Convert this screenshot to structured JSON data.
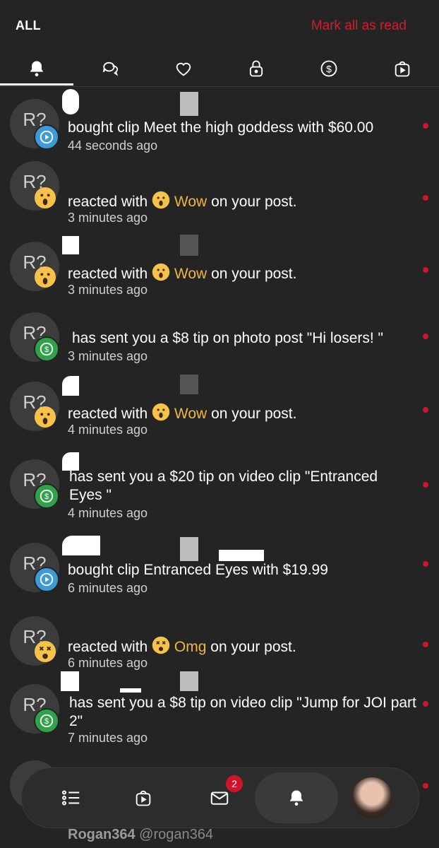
{
  "header": {
    "filter": "ALL",
    "mark_all": "Mark all as read"
  },
  "tabs": [
    {
      "name": "bell-icon"
    },
    {
      "name": "chat-icon"
    },
    {
      "name": "heart-icon"
    },
    {
      "name": "lock-icon"
    },
    {
      "name": "dollar-circle-icon"
    },
    {
      "name": "video-bag-icon"
    }
  ],
  "notifications": [
    {
      "avatar": "R?",
      "badge": "play",
      "text": "bought clip Meet the high goddess with $60.00",
      "time": "44 seconds ago"
    },
    {
      "avatar": "R?",
      "badge": "wow",
      "pre": "reacted with",
      "reaction": "Wow",
      "post": "on your post.",
      "time": "3 minutes ago"
    },
    {
      "avatar": "R?",
      "badge": "wow",
      "pre": "reacted with",
      "reaction": "Wow",
      "post": "on your post.",
      "time": "3 minutes ago"
    },
    {
      "avatar": "R?",
      "badge": "dollar",
      "text": "has sent you a $8 tip on photo post \"Hi losers! \"",
      "time": "3 minutes ago"
    },
    {
      "avatar": "R?",
      "badge": "wow",
      "pre": "reacted with",
      "reaction": "Wow",
      "post": "on your post.",
      "time": "4 minutes ago"
    },
    {
      "avatar": "R?",
      "badge": "dollar",
      "text": "has sent you a $20 tip on video clip \"Entranced Eyes \"",
      "time": "4 minutes ago"
    },
    {
      "avatar": "R?",
      "badge": "play",
      "text": "bought clip Entranced Eyes with $19.99",
      "time": "6 minutes ago"
    },
    {
      "avatar": "R?",
      "badge": "omg",
      "pre": "reacted with",
      "reaction": "Omg",
      "post": "on your post.",
      "time": "6 minutes ago"
    },
    {
      "avatar": "R?",
      "badge": "dollar",
      "text": "has sent you a $8 tip on video clip \"Jump for JOI part 2\"",
      "time": "7 minutes ago"
    }
  ],
  "footer": {
    "username": "Rogan364",
    "handle": "@rogan364"
  },
  "nav": {
    "messages_badge": "2"
  },
  "colors": {
    "accent": "#d21d2b",
    "reaction": "#f0b63c",
    "background": "#242424"
  }
}
